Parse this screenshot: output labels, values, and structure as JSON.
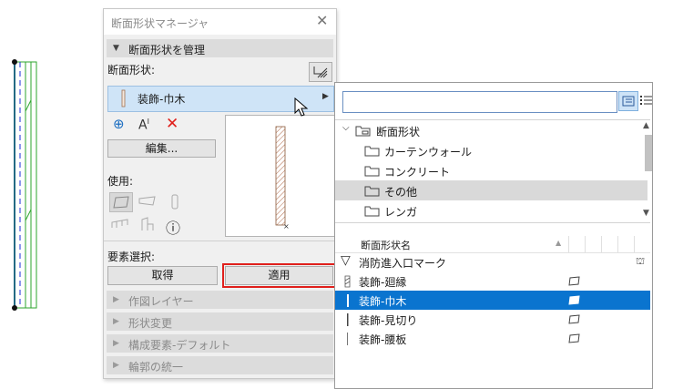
{
  "dialog": {
    "title": "断面形状マネージャ",
    "manage_header": "断面形状を管理",
    "profile_label": "断面形状:",
    "selected_profile": "装飾-巾木",
    "edit_button": "編集...",
    "usage_label": "使用:",
    "element_select_label": "要素選択:",
    "get_button": "取得",
    "apply_button": "適用",
    "collapsed_panels": [
      "作図レイヤー",
      "形状変更",
      "構成要素-デフォルト",
      "輪郭の統一"
    ]
  },
  "popup": {
    "search_value": "",
    "tree": {
      "root": "断面形状",
      "items": [
        "カーテンウォール",
        "コンクリート",
        "その他",
        "レンガ"
      ],
      "selected": "その他"
    },
    "list": {
      "column_header": "断面形状名",
      "rows": [
        {
          "name": "消防進入口マーク",
          "selected": false
        },
        {
          "name": "装飾-廻縁",
          "selected": false
        },
        {
          "name": "装飾-巾木",
          "selected": true
        },
        {
          "name": "装飾-見切り",
          "selected": false
        },
        {
          "name": "装飾-腰板",
          "selected": false
        }
      ]
    }
  },
  "colors": {
    "selection_blue": "#0a74cf",
    "apply_highlight": "#e0201c",
    "wall_line": "#1a2fd8",
    "wall_hatch": "#2ea62e"
  }
}
